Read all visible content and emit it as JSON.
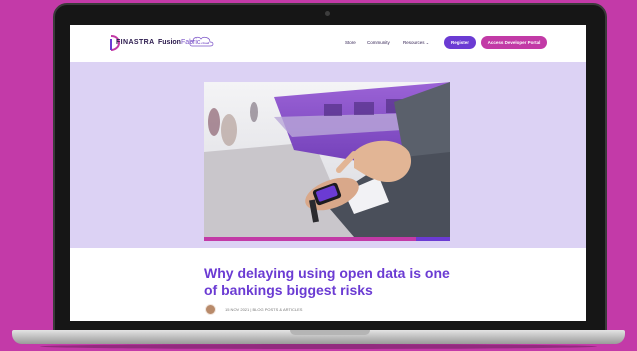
{
  "colors": {
    "background": "#c33aa8",
    "brand_purple": "#6b3bd3",
    "brand_magenta": "#c23aa6",
    "hero_band": "#dcd2f4",
    "title_text": "#6b3bd3"
  },
  "header": {
    "logo_text": "FINASTRA",
    "fusion_bold": "Fusion",
    "fusion_light": "Fabric",
    "fusion_suffix": ".cloud",
    "nav": {
      "store": "Store",
      "community": "Community",
      "resources": "Resources"
    },
    "register_label": "Register",
    "portal_label": "Access Developer Portal"
  },
  "hero": {
    "image_icon": "person-checking-smartwatch-photo"
  },
  "article": {
    "title": "Why delaying using open data is one of bankings biggest risks",
    "meta": "15 NOV 2021 | BLOG POSTS & ARTICLES"
  }
}
